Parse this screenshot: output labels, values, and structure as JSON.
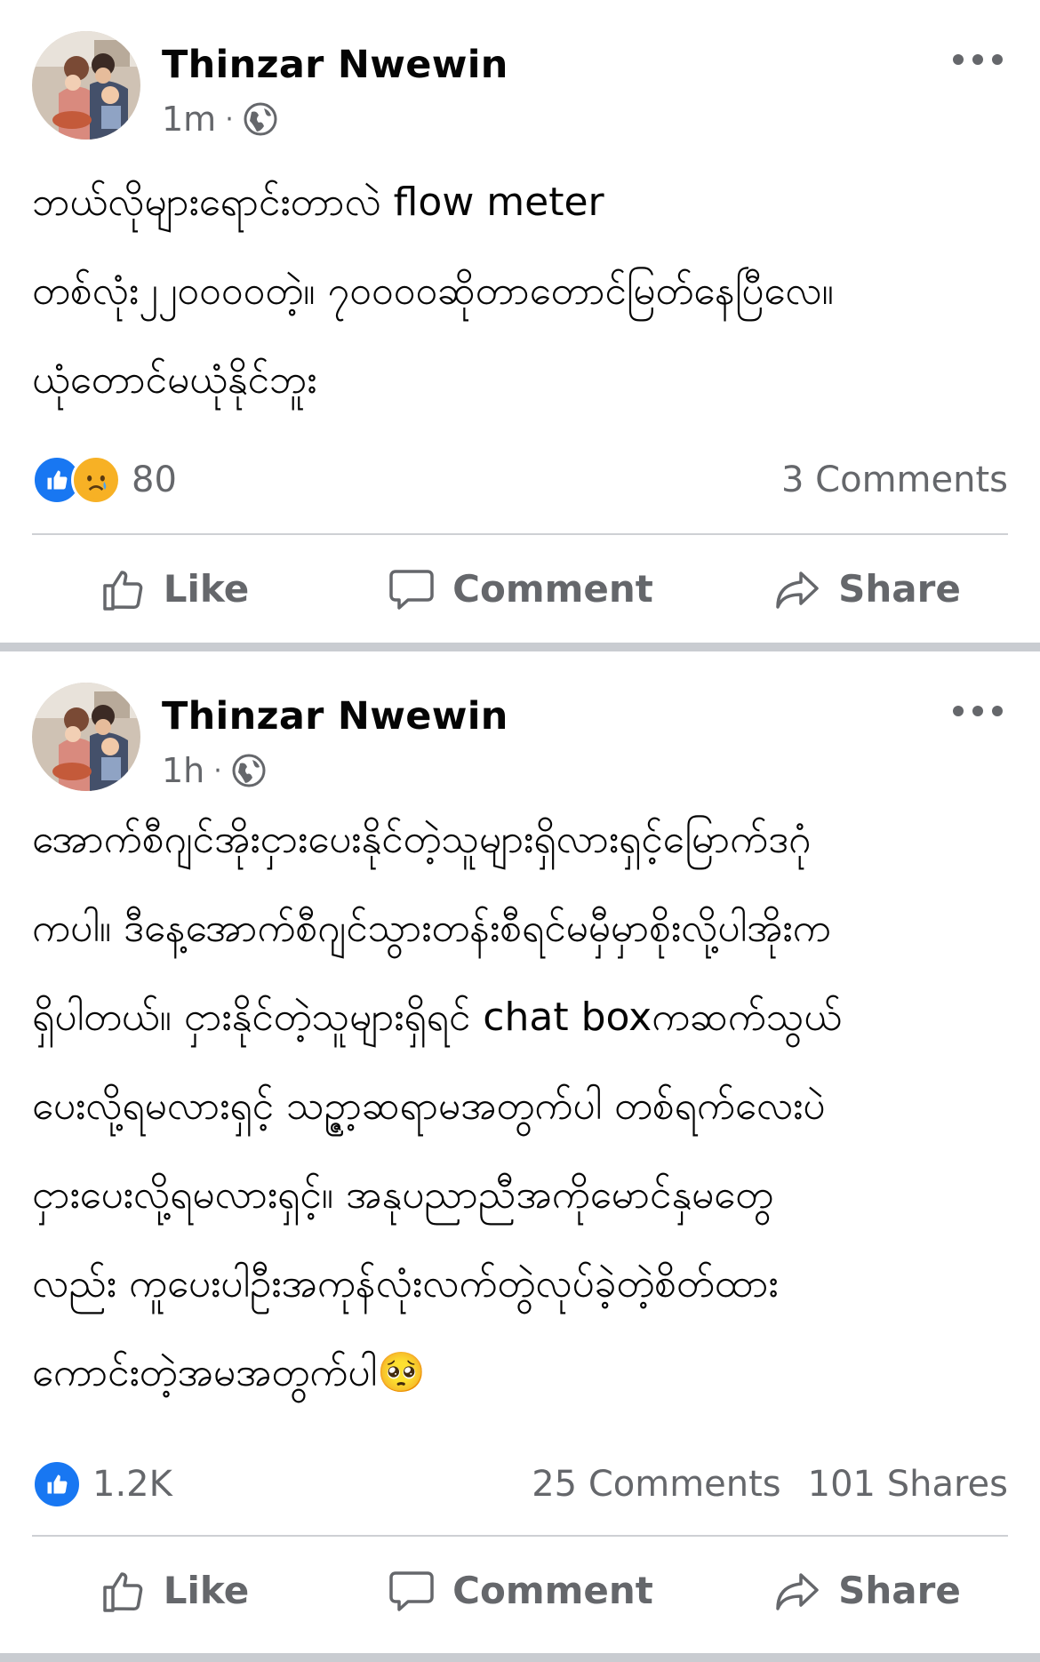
{
  "posts": [
    {
      "author": "Thinzar Nwewin",
      "time": "1m",
      "separator": "·",
      "body": "ဘယ်လိုများရောင်းတာလဲ flow meter\nတစ်လုံး၂၂၀၀၀၀တဲ့။ ၇၀၀၀၀ဆိုတာတောင်မြတ်နေပြီလေ။\nယုံတောင်မယုံနိုင်ဘူး",
      "reaction_count": "80",
      "reaction_icons": [
        "like-icon",
        "sad-icon"
      ],
      "comments": "3 Comments",
      "shares": "",
      "actions": {
        "like": "Like",
        "comment": "Comment",
        "share": "Share"
      }
    },
    {
      "author": "Thinzar Nwewin",
      "time": "1h",
      "separator": "·",
      "body": "အောက်စီဂျင်အိုးငှားပေးနိုင်တဲ့သူများရှိလားရှင့်မြောက်ဒဂုံ\nကပါ။ ဒီနေ့အောက်စီဂျင်သွားတန်းစီရင်မမှီမှာစိုးလို့ပါအိုးက\nရှိပါတယ်။ ငှားနိုင်တဲ့သူများရှိရင် chat boxကဆက်သွယ်\nပေးလို့ရမလားရှင့် သဉ္ဇာ့ဆရာမအတွက်ပါ တစ်ရက်လေးပဲ\nငှားပေးလို့ရမလားရှင့်။ အနုပညာညီအကိုမောင်နှမတွေ\nလည်း ကူပေးပါဦးအကုန်လုံးလက်တွဲလုပ်ခဲ့တဲ့စိတ်ထား\nကောင်းတဲ့အမအတွက်ပါ🥺",
      "reaction_count": "1.2K",
      "reaction_icons": [
        "like-icon"
      ],
      "comments": "25 Comments",
      "shares": "101 Shares",
      "actions": {
        "like": "Like",
        "comment": "Comment",
        "share": "Share"
      }
    }
  ],
  "colors": {
    "like_blue": "#1877f2",
    "secondary_text": "#65676b",
    "separator": "#c9ccd1",
    "sad_yellow": "#f7b125"
  }
}
